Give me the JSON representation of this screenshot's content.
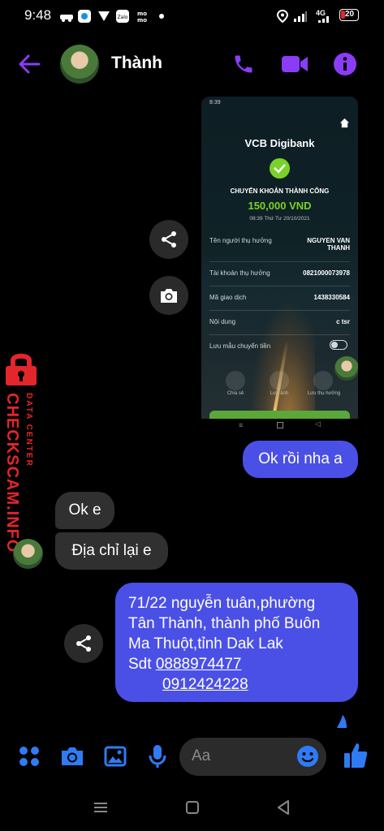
{
  "status_bar": {
    "time": "9:48",
    "battery": "20",
    "network": "4G"
  },
  "header": {
    "contact_name": "Thành"
  },
  "screenshot_card": {
    "time": "8:39",
    "bank_logo": "VCB Digibank",
    "success_title": "CHUYỂN KHOẢN THÀNH CÔNG",
    "amount": "150,000 VND",
    "datetime": "08:39 Thứ Tư 20/10/2021",
    "rows": [
      {
        "label": "Tên người thụ hưởng",
        "value": "NGUYEN VAN THANH"
      },
      {
        "label": "Tài khoản thụ hưởng",
        "value": "0821000073978"
      },
      {
        "label": "Mã giao dịch",
        "value": "1438330584"
      },
      {
        "label": "Nội dung",
        "value": "c tsr"
      },
      {
        "label": "Lưu mẫu chuyển tiền",
        "value": ""
      }
    ],
    "actions": [
      {
        "label": "Chia sẻ"
      },
      {
        "label": "Lưu ảnh"
      },
      {
        "label": "Lưu thụ hưởng"
      }
    ]
  },
  "messages": [
    {
      "side": "out",
      "text": "Ok rồi nha a"
    },
    {
      "side": "in",
      "text": "Ok e"
    },
    {
      "side": "in",
      "text": "Địa chỉ lại e"
    },
    {
      "side": "out",
      "lines": [
        "71/22 nguyễn tuân,phường",
        "Tân Thành, thành phố Buôn",
        "Ma Thuột,tỉnh Dak Lak"
      ],
      "sdt_label": "Sdt",
      "phone1": "0888974477",
      "phone2": "0912424228"
    }
  ],
  "watermark": {
    "brand": "CHECKSCAM.INFO",
    "sub": "DATA CENTER"
  },
  "composer": {
    "placeholder": "Aa"
  },
  "colors": {
    "accent": "#8a3cf7",
    "blue": "#2f7bf5",
    "bubble_out": "#4a50e6",
    "bubble_in": "#303030",
    "watermark_red": "#e3262b",
    "vcb_green": "#7ad12a"
  }
}
